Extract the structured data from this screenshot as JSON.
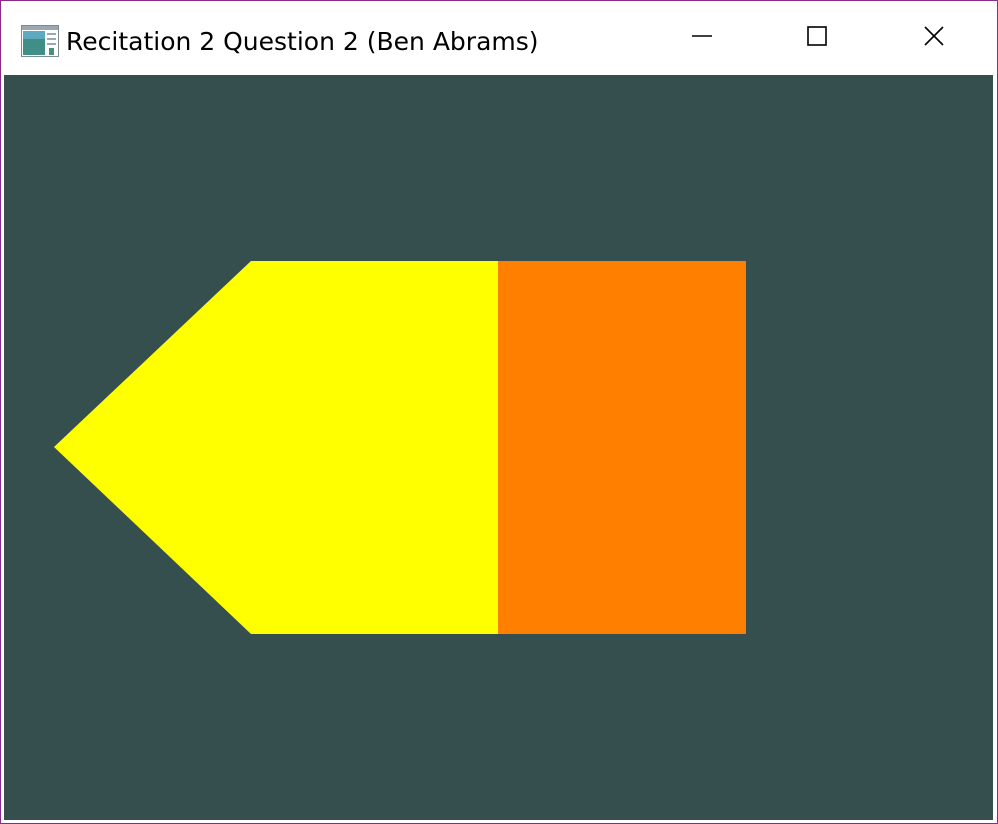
{
  "window": {
    "title": "Recitation 2 Question 2 (Ben Abrams)",
    "icons": {
      "app": "app-window-icon",
      "minimize": "minimize-icon",
      "maximize": "maximize-icon",
      "close": "close-icon"
    }
  },
  "canvas": {
    "background_color": "#354f4f",
    "shapes": [
      {
        "name": "yellow-pentagon",
        "color": "#ffff00"
      },
      {
        "name": "orange-rectangle",
        "color": "#ff8000"
      }
    ]
  }
}
